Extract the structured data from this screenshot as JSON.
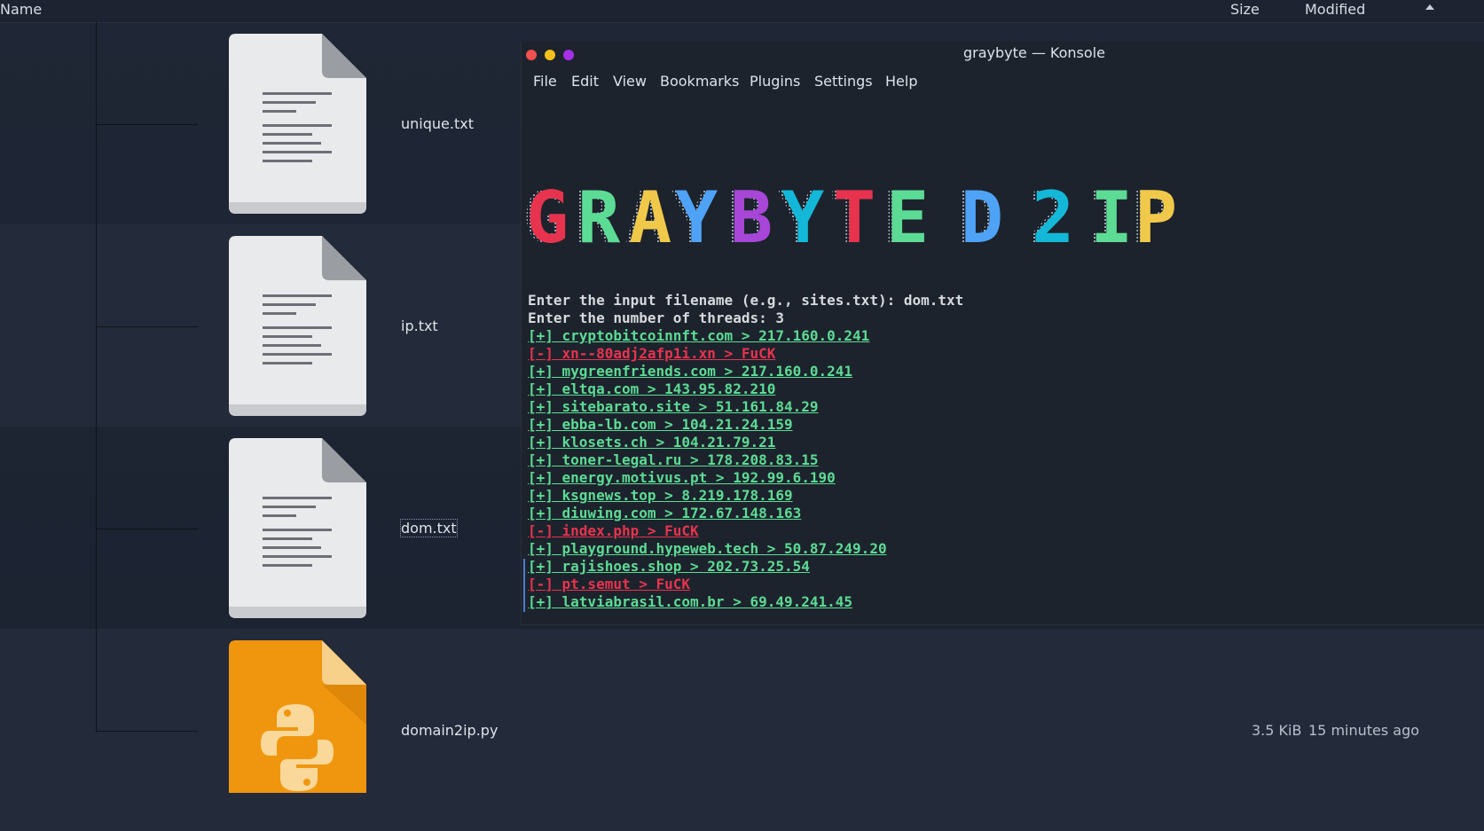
{
  "file_manager": {
    "columns": {
      "name": "Name",
      "size": "Size",
      "modified": "Modified"
    },
    "files": [
      {
        "name": "unique.txt",
        "icon": "text-file-icon",
        "size": "",
        "modified": ""
      },
      {
        "name": "ip.txt",
        "icon": "text-file-icon",
        "size": "",
        "modified": ""
      },
      {
        "name": "dom.txt",
        "icon": "text-file-icon",
        "size": "",
        "modified": "",
        "selected": true
      },
      {
        "name": "domain2ip.py",
        "icon": "python-file-icon",
        "size": "3.5 KiB",
        "modified": "15 minutes ago"
      }
    ]
  },
  "konsole": {
    "title": "graybyte — Konsole",
    "window_buttons": {
      "close": "#f1504e",
      "minimize": "#f5c21b",
      "maximize": "#a530e6"
    },
    "menu": [
      "File",
      "Edit",
      "View",
      "Bookmarks",
      "Plugins",
      "Settings",
      "Help"
    ],
    "banner": {
      "text": "GRAYBYTE D 2 IP",
      "letters": [
        {
          "char": "G",
          "color": "#e8334f"
        },
        {
          "char": "R",
          "color": "#5cdb95"
        },
        {
          "char": "A",
          "color": "#f0c94a"
        },
        {
          "char": "Y",
          "color": "#4fa3f7"
        },
        {
          "char": "B",
          "color": "#a846d8"
        },
        {
          "char": "Y",
          "color": "#13b8d8"
        },
        {
          "char": "T",
          "color": "#e8334f"
        },
        {
          "char": "E",
          "color": "#5cdb95"
        },
        {
          "char": "D",
          "color": "#4fa3f7"
        },
        {
          "char": "2",
          "color": "#13b8d8"
        },
        {
          "char": "I",
          "color": "#5cdb95"
        },
        {
          "char": "P",
          "color": "#f0c94a"
        }
      ]
    },
    "lines": [
      {
        "text": "Enter the input filename (e.g., sites.txt): dom.txt",
        "kind": "plain"
      },
      {
        "text": "Enter the number of threads: 3",
        "kind": "plain"
      },
      {
        "text": "[+] cryptobitcoinnft.com > 217.160.0.241",
        "kind": "ok"
      },
      {
        "text": "[-] xn--80adj2afp1i.xn > FuCK",
        "kind": "err"
      },
      {
        "text": "[+] mygreenfriends.com > 217.160.0.241",
        "kind": "ok"
      },
      {
        "text": "[+] eltqa.com > 143.95.82.210",
        "kind": "ok"
      },
      {
        "text": "[+] sitebarato.site > 51.161.84.29",
        "kind": "ok"
      },
      {
        "text": "[+] ebba-lb.com > 104.21.24.159",
        "kind": "ok"
      },
      {
        "text": "[+] klosets.ch > 104.21.79.21",
        "kind": "ok"
      },
      {
        "text": "[+] toner-legal.ru > 178.208.83.15",
        "kind": "ok"
      },
      {
        "text": "[+] energy.motivus.pt > 192.99.6.190",
        "kind": "ok"
      },
      {
        "text": "[+] ksgnews.top > 8.219.178.169",
        "kind": "ok"
      },
      {
        "text": "[+] diuwing.com > 172.67.148.163",
        "kind": "ok"
      },
      {
        "text": "[-] index.php > FuCK",
        "kind": "err"
      },
      {
        "text": "[+] playground.hypeweb.tech > 50.87.249.20",
        "kind": "ok"
      },
      {
        "text": "[+] rajishoes.shop > 202.73.25.54",
        "kind": "ok"
      },
      {
        "text": "[-] pt.semut > FuCK",
        "kind": "err"
      },
      {
        "text": "[+] latviabrasil.com.br > 69.49.241.45",
        "kind": "ok"
      }
    ]
  }
}
